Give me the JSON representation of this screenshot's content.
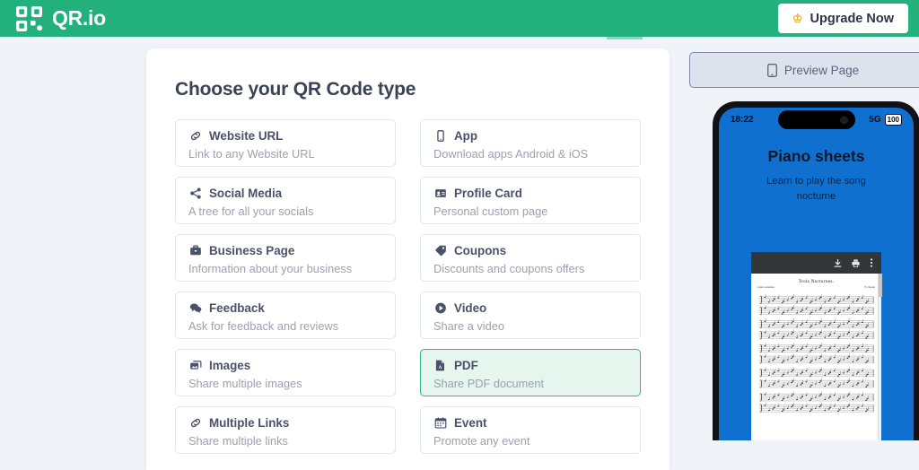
{
  "header": {
    "brand": "QR.io",
    "brand_logo_icon": "qr-code-icon",
    "upgrade_label": "Upgrade Now",
    "upgrade_icon": "crown-icon",
    "bg_color": "#22b07d"
  },
  "main": {
    "title": "Choose your QR Code type",
    "types": [
      {
        "label": "Website URL",
        "desc": "Link to any Website URL",
        "icon": "link-icon",
        "selected": false
      },
      {
        "label": "App",
        "desc": "Download apps Android & iOS",
        "icon": "mobile-icon",
        "selected": false
      },
      {
        "label": "Social Media",
        "desc": "A tree for all your socials",
        "icon": "share-icon",
        "selected": false
      },
      {
        "label": "Profile Card",
        "desc": "Personal custom page",
        "icon": "id-card-icon",
        "selected": false
      },
      {
        "label": "Business Page",
        "desc": "Information about your business",
        "icon": "briefcase-icon",
        "selected": false
      },
      {
        "label": "Coupons",
        "desc": "Discounts and coupons offers",
        "icon": "tag-icon",
        "selected": false
      },
      {
        "label": "Feedback",
        "desc": "Ask for feedback and reviews",
        "icon": "comments-icon",
        "selected": false
      },
      {
        "label": "Video",
        "desc": "Share a video",
        "icon": "play-circle-icon",
        "selected": false
      },
      {
        "label": "Images",
        "desc": "Share multiple images",
        "icon": "images-icon",
        "selected": false
      },
      {
        "label": "PDF",
        "desc": "Share PDF document",
        "icon": "pdf-file-icon",
        "selected": true
      },
      {
        "label": "Multiple Links",
        "desc": "Share multiple links",
        "icon": "link-icon",
        "selected": false
      },
      {
        "label": "Event",
        "desc": "Promote any event",
        "icon": "calendar-icon",
        "selected": false
      }
    ],
    "selected_accent": "#35b58a",
    "selected_bg": "#e6f5ee"
  },
  "preview": {
    "button_label": "Preview Page",
    "button_icon": "mobile-icon",
    "phone": {
      "status_time": "18:22",
      "status_network": "5G",
      "status_battery": "100",
      "screen_bg": "#0f70cf",
      "title": "Piano sheets",
      "subtitle": "Learn to play the song nocturne",
      "pdf_toolbar_icons": [
        "download-icon",
        "print-icon",
        "more-options-icon"
      ],
      "document_title": "Trois Nocturnes.",
      "document_tempo": "Lento sostenuto",
      "document_author": "F. Chopin"
    }
  }
}
